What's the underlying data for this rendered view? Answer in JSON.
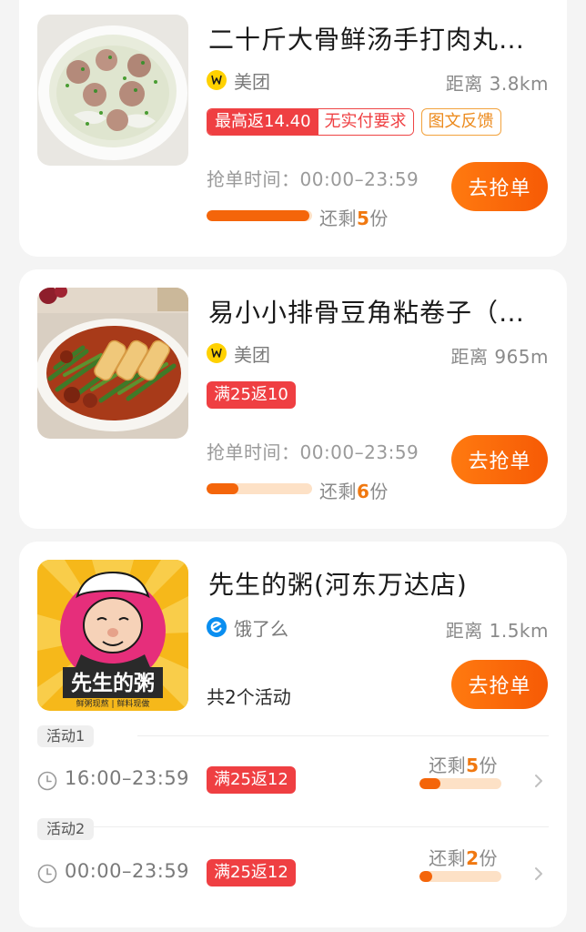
{
  "cards": [
    {
      "title": "二十斤大骨鲜汤手打肉丸…",
      "platform": "美团",
      "platform_icon": "meituan-icon",
      "distance": "距离 3.8km",
      "tags": {
        "rebate_left": "最高返14.40",
        "rebate_right": "无实付要求",
        "feedback": "图文反馈"
      },
      "grab_time": "抢单时间：00:00–23:59",
      "remaining_prefix": "还剩",
      "remaining_count": "5",
      "remaining_suffix": "份",
      "progress": 0.97,
      "button": "去抢单"
    },
    {
      "title": "易小小排骨豆角粘卷子（…",
      "platform": "美团",
      "platform_icon": "meituan-icon",
      "distance": "距离 965m",
      "tags": {
        "rebate": "满25返10"
      },
      "grab_time": "抢单时间：00:00–23:59",
      "remaining_prefix": "还剩",
      "remaining_count": "6",
      "remaining_suffix": "份",
      "progress": 0.3,
      "button": "去抢单"
    },
    {
      "title": "先生的粥(河东万达店)",
      "platform": "饿了么",
      "platform_icon": "eleme-icon",
      "distance": "距离 1.5km",
      "activity_count": "共2个活动",
      "button": "去抢单",
      "logo_text": "先生的粥",
      "logo_subtext": "鲜粥现熬 | 鲜料现做",
      "activities": [
        {
          "label": "活动1",
          "time": "16:00–23:59",
          "rebate": "满25返12",
          "remaining_prefix": "还剩",
          "remaining_count": "5",
          "remaining_suffix": "份",
          "progress": 0.25
        },
        {
          "label": "活动2",
          "time": "00:00–23:59",
          "rebate": "满25返12",
          "remaining_prefix": "还剩",
          "remaining_count": "2",
          "remaining_suffix": "份",
          "progress": 0.15
        }
      ]
    }
  ],
  "colors": {
    "accent": "#f65a05",
    "tag_red": "#ef3f42",
    "tag_orange": "#ec8a1c",
    "progress_track": "#fde1c6",
    "meituan_yellow": "#ffd100",
    "eleme_blue": "#0a8ef0"
  }
}
